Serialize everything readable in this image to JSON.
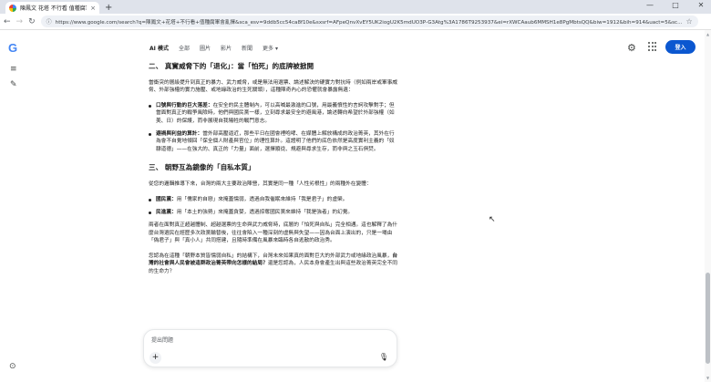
{
  "browser": {
    "tab_title": "陳鳳文 花塔 不行看 值種腐軍會亂…",
    "tab_close": "×",
    "new_tab": "+",
    "window_controls": [
      "—",
      "□",
      "✕"
    ],
    "url": "https://www.google.com/search?q=陳鳳文+花塔+不行看+值種腐軍會亂擇&sca_esv=9ddb5cc54ca8f10e&sxsrf=AFpeQnvXvEY5UK2iogU2K5mdUO3P-G3Atg%3A1786T9253937&ei=rXWCAaub6MMSH1e8PgMbtsQQ&biw=1912&bih=914&uact=5&sc..."
  },
  "icons": {
    "back": "←",
    "forward": "→",
    "reload": "↻",
    "info": "ⓘ",
    "star": "☆",
    "menu": "⋮",
    "rail_menu": "≡",
    "rail_edit": "✎",
    "settings": "⚙",
    "help": "⊙",
    "plus": "+",
    "mic": "🎙",
    "cursor": "↖",
    "scroll_up": "▲",
    "scroll_down": "▼"
  },
  "logo": "G",
  "nav": {
    "items": [
      "AI 模式",
      "全部",
      "圖片",
      "影片",
      "新聞",
      "更多 ▾"
    ],
    "signin": "登入"
  },
  "content": {
    "section2_title": "二、 真實威脅下的「退化」：當「怕死」的底牌被掀開",
    "section2_para": "當衝突的層級提升到真正的暴力、武力威脅，或是無法用選票、論述解決的硬實力對抗時（例如兩岸或軍事威脅、外部強權的實力施壓、或地緣政治的生死關頭），這種陳奇內心的恐懼就會暴露無遺：",
    "bullets2": [
      {
        "bold": "口號與行動的巨大落差：",
        "text": "在安全的民主體制內，可以高喊最激進的口號，用最義憤性的言詞攻擊對手；但當面對真正的戰爭風險時，他們與國民黨一樣，立刻尋求最安全的避風港，論述轉向希望於外部強權（如美、日）的保護，而非展現自我犧牲的戰鬥意志。"
      },
      {
        "bold": "避禍與利益的算計：",
        "text": "當外部高壓逼近，那些平日在國會裡咆哮、在媒體上解放構成的政治菁英，其外在行為會不自覺地傾回「保全個人財產與官位」的理性算計。這證明了他們的底色依然是高度實利主義的「奴隸道德」——在強大的、真正的「力量」面前，選擇順從、規避與尋求生存，而非與之玉石俱焚。"
      }
    ],
    "section3_title": "三、 朝野互為鏡像的「自私本質」",
    "section3_para": "從您的邏輯推導下來，台灣的兩大主要政治陣營，其實是同一種「人性劣根性」的兩種外在變體：",
    "bullets3": [
      {
        "bold": "國民黨：",
        "text": "用「儒家的自戀」來掩蓋懦弱，透過自我催眠來維持「我是君子」的虛榮。"
      },
      {
        "bold": "民進黨：",
        "text": "用「本土的強勢」來掩蓋貪婪，透過掠奪國民黨來維持「我是強者」的幻覺。"
      }
    ],
    "para_a": "兩者在面對真正超越體制、超越選票的生命與武力威脅時，底層的「怕死與自私」完全相通。這也解釋了為什麼台灣選民在經歷多次政黨輪替後，往往會陷入一種深刻的虛無與失望——因為台面上演出的，只是一場由「偽君子」與「真小人」共同搭建，且隨時準備在風暴來臨時各自逃散的政治秀。",
    "para_b_lead": "您認為在這種「朝野本質皆懦弱自私」的結構下，台灣未來如果真的面對巨大的外部武力或地緣政治風暴，",
    "para_b_bold": "台灣的社會與人民會被這群政治菁英帶向怎樣的結局？",
    "para_b_tail": "還是您認為，人民本身會產生出與這些政治菁英完全不同的生命力？"
  },
  "ask": {
    "placeholder": "提出問題"
  }
}
